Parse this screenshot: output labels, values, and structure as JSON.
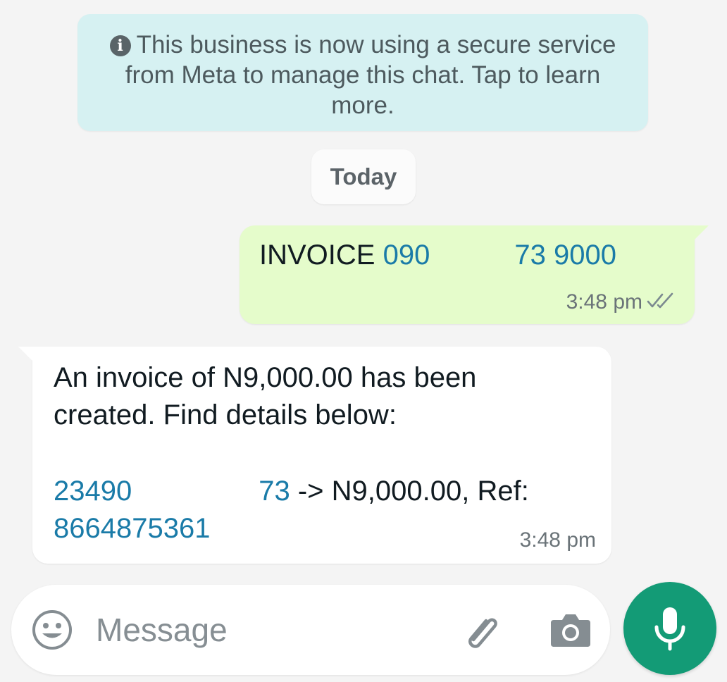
{
  "notice": {
    "icon": "info-icon",
    "text": "This business is now using a secure service from Meta to manage this chat. Tap to learn more."
  },
  "date_divider": {
    "label": "Today"
  },
  "messages": [
    {
      "direction": "outgoing",
      "prefix": "INVOICE",
      "linked": "090      73 9000",
      "time": "3:48 pm",
      "status_icon": "double-check-icon"
    },
    {
      "direction": "incoming",
      "line1": "An invoice of N9,000.00 has been",
      "line2": "created. Find details below:",
      "phone": "23490     73",
      "mid_text": " -> N9,000.00, Ref:",
      "ref": "8664875361",
      "time": "3:48 pm"
    }
  ],
  "composer": {
    "placeholder": "Message",
    "emoji_icon": "emoji-icon",
    "attach_icon": "paperclip-icon",
    "camera_icon": "camera-icon"
  },
  "mic_button": {
    "icon": "microphone-icon"
  },
  "colors": {
    "background": "#f4f4f4",
    "notice_bg": "#d6f1f2",
    "outgoing_bg": "#e5fccb",
    "incoming_bg": "#ffffff",
    "link": "#1a7ba8",
    "mic_bg": "#139b76"
  }
}
